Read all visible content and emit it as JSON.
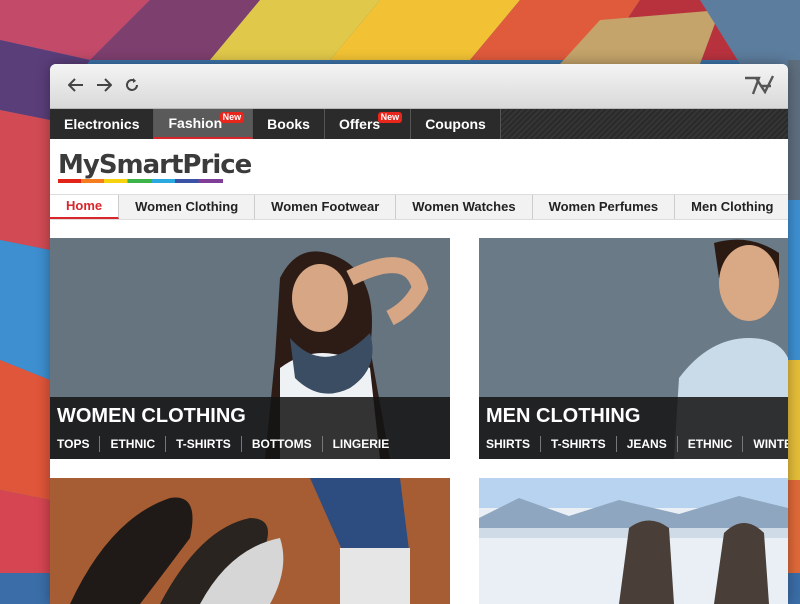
{
  "browser": {
    "back_icon": "arrow-left-icon",
    "forward_icon": "arrow-right-icon",
    "reload_icon": "reload-icon",
    "extension_icon": "ta-logo-icon"
  },
  "topnav": {
    "items": [
      {
        "label": "Electronics",
        "badge": ""
      },
      {
        "label": "Fashion",
        "badge": "New"
      },
      {
        "label": "Books",
        "badge": ""
      },
      {
        "label": "Offers",
        "badge": "New"
      },
      {
        "label": "Coupons",
        "badge": ""
      }
    ]
  },
  "brand": {
    "name": "MySmartPrice"
  },
  "subnav": {
    "items": [
      "Home",
      "Women Clothing",
      "Women Footwear",
      "Women Watches",
      "Women Perfumes",
      "Men Clothing"
    ]
  },
  "cards": [
    {
      "title": "WOMEN CLOTHING",
      "links": [
        "TOPS",
        "ETHNIC",
        "T-SHIRTS",
        "BOTTOMS",
        "LINGERIE"
      ]
    },
    {
      "title": "MEN CLOTHING",
      "links": [
        "SHIRTS",
        "T-SHIRTS",
        "JEANS",
        "ETHNIC",
        "WINTER"
      ]
    }
  ],
  "colors": {
    "accent": "#d9262b",
    "badge": "#e8261c",
    "nav_bg": "#2b2b2b"
  }
}
